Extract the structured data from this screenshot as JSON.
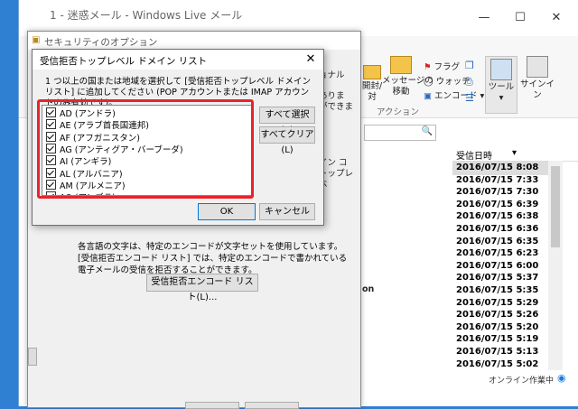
{
  "main_window": {
    "title": "1 - 迷惑メール - Windows Live メール",
    "ribbon": {
      "flag": "フラグ",
      "watch": "ウォッチ",
      "encode": "エンコード",
      "open_label": "開封/\n対",
      "message_move": "メッセージの\n移動",
      "tools": "ツール",
      "signin": "サインイン",
      "action_group": "アクション"
    },
    "column_header": "受信日時",
    "dates": [
      "2016/07/15 8:08",
      "2016/07/15 7:33",
      "2016/07/15 7:30",
      "2016/07/15 6:39",
      "2016/07/15 6:38",
      "2016/07/15 6:36",
      "2016/07/15 6:35",
      "2016/07/15 6:23",
      "2016/07/15 6:00",
      "2016/07/15 5:37",
      "2016/07/15 5:35",
      "2016/07/15 5:29",
      "2016/07/15 5:26",
      "2016/07/15 5:20",
      "2016/07/15 5:19",
      "2016/07/15 5:13",
      "2016/07/15 5:02"
    ],
    "status": "オンライン作業中"
  },
  "security_dialog": {
    "title": "セキュリティのオプション",
    "description": "各言語の文字は、特定のエンコードが文字セットを使用しています。[受信拒否エンコード リスト] では、特定のエンコードで書かれている電子メールの受信を拒否することができます。",
    "encode_list_button": "受信拒否エンコード リスト(L)..."
  },
  "tld_dialog": {
    "title": "受信拒否トップレベル ドメイン リスト",
    "instruction": "1 つ以上の国または地域を選択して [受信拒否トップレベル ドメイン リスト] に追加してください (POP アカウントまたは IMAP アカウントのみ有効です)。",
    "items": [
      "AD (アンドラ)",
      "AE (アラブ首長国連邦)",
      "AF (アフガニスタン)",
      "AG (アンティグア・バーブーダ)",
      "AI (アンギラ)",
      "AL (アルバニア)",
      "AM (アルメニア)",
      "AO (アンゴラ)"
    ],
    "select_all": "すべて選択(S)",
    "clear_all": "すべてクリア(L)",
    "ok": "OK",
    "cancel": "キャンセル"
  },
  "colors": {
    "highlight": "#e8232c",
    "desktop": "#2f7fd3"
  }
}
